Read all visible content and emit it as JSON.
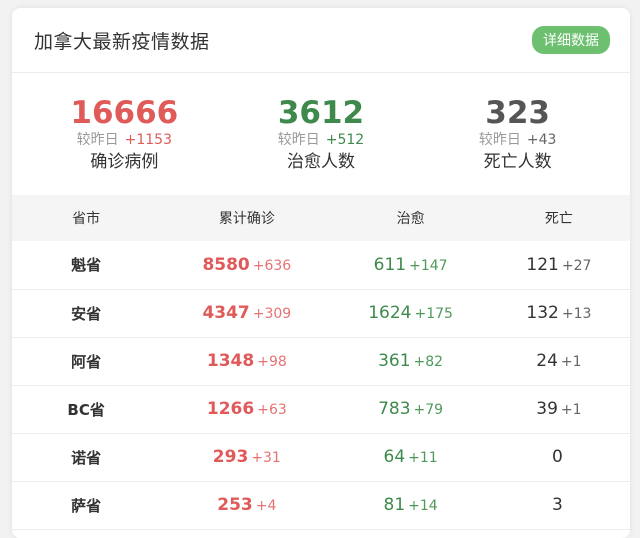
{
  "header": {
    "title": "加拿大最新疫情数据",
    "detail_button": "详细数据"
  },
  "colors": {
    "confirmed": "#e05a5a",
    "recovered": "#3e8a4c",
    "deaths": "#555555",
    "button": "#6dc070"
  },
  "summary": [
    {
      "key": "confirmed",
      "number": "16666",
      "change_label": "较昨日",
      "delta": "+1153",
      "label": "确诊病例"
    },
    {
      "key": "recovered",
      "number": "3612",
      "change_label": "较昨日",
      "delta": "+512",
      "label": "治愈人数"
    },
    {
      "key": "deaths",
      "number": "323",
      "change_label": "较昨日",
      "delta": "+43",
      "label": "死亡人数"
    }
  ],
  "table": {
    "headers": [
      "省市",
      "累计确诊",
      "治愈",
      "死亡"
    ],
    "rows": [
      {
        "province": "魁省",
        "confirmed": "8580",
        "confirmed_inc": "+636",
        "recovered": "611",
        "recovered_inc": "+147",
        "deaths": "121",
        "deaths_inc": "+27"
      },
      {
        "province": "安省",
        "confirmed": "4347",
        "confirmed_inc": "+309",
        "recovered": "1624",
        "recovered_inc": "+175",
        "deaths": "132",
        "deaths_inc": "+13"
      },
      {
        "province": "阿省",
        "confirmed": "1348",
        "confirmed_inc": "+98",
        "recovered": "361",
        "recovered_inc": "+82",
        "deaths": "24",
        "deaths_inc": "+1"
      },
      {
        "province": "BC省",
        "confirmed": "1266",
        "confirmed_inc": "+63",
        "recovered": "783",
        "recovered_inc": "+79",
        "deaths": "39",
        "deaths_inc": "+1"
      },
      {
        "province": "诺省",
        "confirmed": "293",
        "confirmed_inc": "+31",
        "recovered": "64",
        "recovered_inc": "+11",
        "deaths": "0",
        "deaths_inc": ""
      },
      {
        "province": "萨省",
        "confirmed": "253",
        "confirmed_inc": "+4",
        "recovered": "81",
        "recovered_inc": "+14",
        "deaths": "3",
        "deaths_inc": ""
      }
    ]
  }
}
